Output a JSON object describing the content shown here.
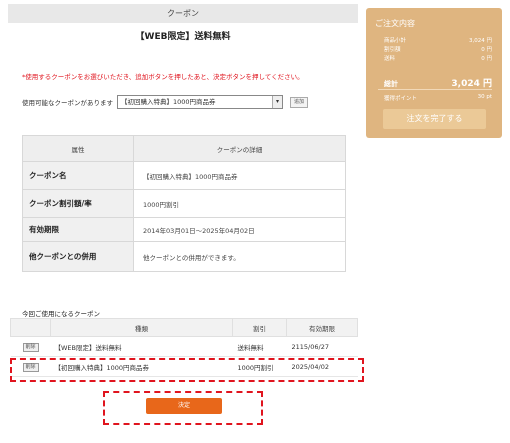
{
  "page": {
    "title": "クーポン",
    "subtitle": "【WEB限定】送料無料",
    "notice": "*使用するクーポンをお選びいただき、追加ボタンを押したあと、決定ボタンを押してください。"
  },
  "coupon_select": {
    "label": "使用可能なクーポンがあります",
    "selected": "【初回購入特典】1000円商品券",
    "arrow": "▾",
    "add_label": "追加"
  },
  "detail_table": {
    "headers": [
      "属性",
      "クーポンの詳細"
    ],
    "rows": [
      {
        "key": "クーポン名",
        "value": "【初回購入特典】1000円商品券"
      },
      {
        "key": "クーポン割引額/率",
        "value": "1000円割引"
      },
      {
        "key": "有効期限",
        "value": "2014年03月01日～2025年04月02日"
      },
      {
        "key": "他クーポンとの併用",
        "value": "他クーポンとの併用ができます。"
      }
    ]
  },
  "used_coupons": {
    "caption": "今回ご使用になるクーポン",
    "headers": [
      "",
      "種類",
      "割引",
      "有効期限"
    ],
    "delete_label": "削除",
    "rows": [
      {
        "name": "【WEB限定】送料無料",
        "discount": "送料無料",
        "expiry": "2115/06/27"
      },
      {
        "name": "【初回購入特典】1000円商品券",
        "discount": "1000円割引",
        "expiry": "2025/04/02"
      }
    ]
  },
  "confirm_button": "決定",
  "sidebar": {
    "title": "ご注文内容",
    "rows": [
      {
        "label": "商品小計",
        "value": "3,024 円"
      },
      {
        "label": "割引額",
        "value": "0 円"
      },
      {
        "label": "送料",
        "value": "0 円"
      }
    ],
    "total_label": "総計",
    "total_value": "3,024 円",
    "points_label": "獲得ポイント",
    "points_value": "30 pt",
    "order_button": "注文を完了する"
  },
  "colors": {
    "sidebar_bg": "#dfb580",
    "accent_orange": "#e8671a",
    "notice_red": "#e0141e"
  }
}
